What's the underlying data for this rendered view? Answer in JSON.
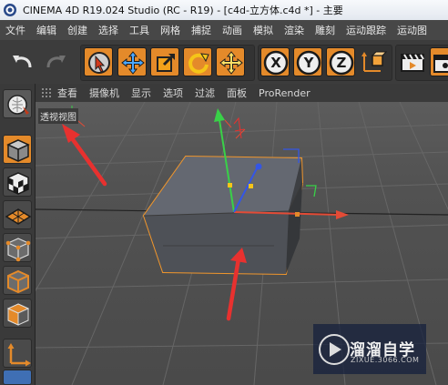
{
  "window": {
    "title": "CINEMA 4D R19.024 Studio (RC - R19) - [c4d-立方体.c4d *] - 主要"
  },
  "menu": {
    "items": [
      "文件",
      "编辑",
      "创建",
      "选择",
      "工具",
      "网格",
      "捕捉",
      "动画",
      "模拟",
      "渲染",
      "雕刻",
      "运动跟踪",
      "运动图"
    ]
  },
  "toolbar": {
    "axis_labels": [
      "X",
      "Y",
      "Z"
    ]
  },
  "viewport": {
    "menu": [
      "查看",
      "摄像机",
      "显示",
      "选项",
      "过滤",
      "面板",
      "ProRender"
    ],
    "label": "透视视图"
  },
  "watermark": {
    "name": "溜溜自学",
    "url": "ZIXUE.3066.COM"
  },
  "colors": {
    "accent_orange": "#e48a2a",
    "annotation_red": "#e8312f",
    "axis_x": "#e34b36",
    "axis_y": "#39d148",
    "axis_z": "#3456e6",
    "selection_outline": "#f0962c"
  },
  "icons": [
    "undo-icon",
    "redo-icon",
    "live-select-icon",
    "move-icon",
    "scale-icon",
    "rotate-icon",
    "recent-tool-icon",
    "coordinate-system-icon",
    "render-view-icon",
    "render-picture-queue-icon",
    "model-mode-icon",
    "texture-mode-icon",
    "workplane-icon",
    "points-mode-icon",
    "edges-mode-icon",
    "polygons-mode-icon",
    "axis-mode-icon"
  ]
}
